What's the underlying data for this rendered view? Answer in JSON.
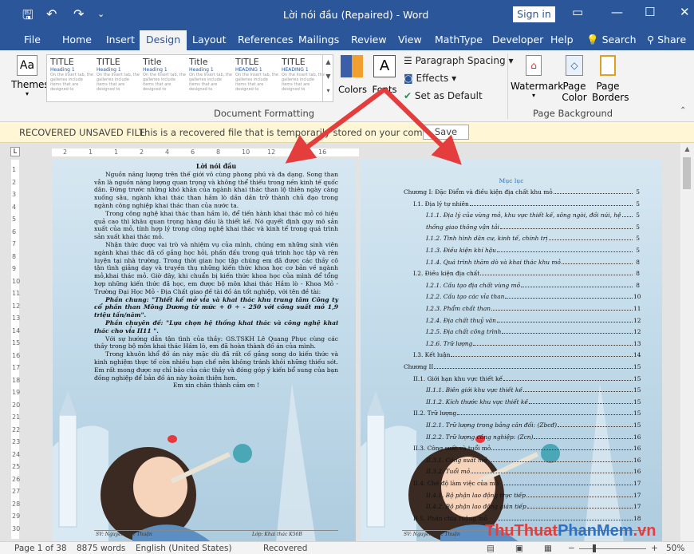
{
  "window": {
    "title": "Lời nói đầu (Repaired)  -  Word",
    "signin": "Sign in",
    "minimize": "—",
    "restore": "☐",
    "close": "✕"
  },
  "quick_access": {
    "save": "🖫",
    "undo": "↶",
    "redo": "↷",
    "more": "⌄"
  },
  "tabs": [
    "File",
    "Home",
    "Insert",
    "Design",
    "Layout",
    "References",
    "Mailings",
    "Review",
    "View",
    "MathType",
    "Developer",
    "Help"
  ],
  "active_tab": "Design",
  "tell_me": "Search",
  "share": "Share",
  "ribbon": {
    "themes_label": "Themes",
    "style_titles": [
      "TITLE",
      "TITLE",
      "Title",
      "Title",
      "TITLE",
      "TITLE"
    ],
    "style_headings": [
      "Heading 1",
      "Heading 1",
      "Heading 1",
      "Heading 1",
      "HEADING 1",
      "HEADING 1"
    ],
    "style_sample": "On the Insert tab, the galleries include items that are designed to",
    "colors_label": "Colors",
    "fonts_label": "Fonts",
    "fonts_glyph": "A",
    "paragraph_spacing": "Paragraph Spacing",
    "effects": "Effects",
    "set_default": "Set as Default",
    "group_document_formatting": "Document Formatting",
    "watermark": "Watermark",
    "page_color": "Page Color",
    "page_borders": "Page Borders",
    "group_page_background": "Page Background"
  },
  "notification": {
    "title": "RECOVERED UNSAVED FILE",
    "message": "This is a recovered file that is temporarily stored on your computer.",
    "save_button": "Save"
  },
  "page1": {
    "heading": "Lời nói đầu",
    "paragraphs": [
      "Nguồn năng lượng trên thế giới vô cùng phong phú và đa dạng. Song than vẫn là nguồn năng lượng quan trọng và không thể thiếu trong nền kinh tế quốc dân. Đứng trước những khó khăn của ngành khai thác than lộ thiên ngày càng xuống sâu, ngành khai thác than hầm lò dần dần trở thành chủ đạo trong ngành công nghiệp khai thác than của nước ta.",
      "Trong công nghệ khai thác than hầm lò, để tiến hành khai thác mỏ có hiệu quả cao thì khâu quan trọng hàng đầu là thiết kế. Nó quyết định quy mô sản xuất của mỏ, tính hợp lý trong công nghệ khai thác và kinh tế trong quá trình sản xuất khai thác mỏ.",
      "Nhận thức được vai trò và nhiệm vụ của mình, chúng em những sinh viên ngành khai thác đã cố gắng học hỏi, phấn đấu trong quá trình học tập và rèn luyện tại nhà trường. Trong thời gian học tập chúng em đã được các thầy cô tận tình giảng dạy và truyền thụ những kiến thức khoa học cơ bản về ngành mỏ,khai thác mỏ. Giờ đây, khi chuẩn bị kiến thức khoa học của mình để tổng hợp những kiến thức đã học, em được bộ môn khai thác Hầm lò - Khoa Mỏ - Trường Đại Học Mỏ - Địa Chất giao đề tài đồ án tốt nghiệp, với tên đề tài:",
      "Phần chung: \"Thiết kế mở vỉa và khai thác khu trung tâm Công ty cổ phần than Mông Dương từ mức + 0 ÷ - 250 với công suất mỏ 1,9 triệu tấn/năm\".",
      "Phần chuyên đề: \"Lựa chọn hệ thống khai thác và công nghệ khai thác cho vỉa II11 \".",
      "Với sự hướng dẫn tận tình của thầy: GS.TSKH Lê Quang Phục cùng các thầy trong bộ môn khai thác Hầm lò, em đã hoàn thành đồ án của mình.",
      "Trong khuôn khổ đồ án này mặc dù đã rất cố gắng song do kiến thức và kinh nghiệm thực tế còn nhiều hạn chế nên không tránh khỏi những thiếu sót. Em rất mong được sự chỉ bảo của các thầy và đóng góp ý kiến bổ sung của bạn đồng nghiệp để bản đồ án này hoàn thiện hơn.",
      "Em xin chân thành cảm ơn !"
    ],
    "footer_left": "SV: Nguyễn Đức Thuận",
    "footer_right": "Lớp: Khai thác K56B"
  },
  "page2": {
    "toc_title": "Mục lục",
    "toc": [
      {
        "label": "Chương I: Đặc Điểm và điều kiện địa chất khu mỏ",
        "page": "5",
        "level": 0,
        "italic": false
      },
      {
        "label": "I.1. Địa lý tự  nhiên",
        "page": "5",
        "level": 1,
        "italic": false
      },
      {
        "label": "I.1.1. Địa lý của vùng mỏ, khu vực thiết kế, sông ngòi, đồi núi, hệ",
        "page": "5",
        "level": 2,
        "italic": true
      },
      {
        "label": "thống giao thông vận tải",
        "page": "5",
        "level": 2,
        "italic": true
      },
      {
        "label": "I.1.2.  Tình hình dân cư, kinh tế, chính trị",
        "page": "5",
        "level": 2,
        "italic": true
      },
      {
        "label": "I.1.3. Điều kiện khí hậu",
        "page": "5",
        "level": 2,
        "italic": true
      },
      {
        "label": "I.1.4. Quá trình thăm dò và khai thác khu mỏ",
        "page": "8",
        "level": 2,
        "italic": true
      },
      {
        "label": "I.2. Điều kiện địa chất",
        "page": "8",
        "level": 1,
        "italic": false
      },
      {
        "label": "I.2.1.  Cấu tạo địa chất vùng mỏ",
        "page": "8",
        "level": 2,
        "italic": true
      },
      {
        "label": "I.2.2. Cấu tạo các vỉa than",
        "page": "10",
        "level": 2,
        "italic": true
      },
      {
        "label": "I.2.3. Phẩm chất than",
        "page": "11",
        "level": 2,
        "italic": true
      },
      {
        "label": "I.2.4. Địa chất thuỷ văn",
        "page": "12",
        "level": 2,
        "italic": true
      },
      {
        "label": "I.2.5. Địa chất công trình",
        "page": "12",
        "level": 2,
        "italic": true
      },
      {
        "label": "I.2.6. Trữ lượng",
        "page": "13",
        "level": 2,
        "italic": true
      },
      {
        "label": "I.3. Kết luận",
        "page": "14",
        "level": 1,
        "italic": false
      },
      {
        "label": "Chương II",
        "page": "15",
        "level": 0,
        "italic": false
      },
      {
        "label": "II.1. Giới hạn khu vực thiết kế",
        "page": "15",
        "level": 1,
        "italic": false
      },
      {
        "label": "II.1.1. Biên giới khu vực thiết kế",
        "page": "15",
        "level": 2,
        "italic": true
      },
      {
        "label": "II.1.2. Kích thước khu vực thiết kế",
        "page": "15",
        "level": 2,
        "italic": true
      },
      {
        "label": "II.2. Trữ lượng",
        "page": "15",
        "level": 1,
        "italic": false
      },
      {
        "label": "II.2.1. Trữ lượng trong bảng cân đối: (Zbcđ)",
        "page": "15",
        "level": 2,
        "italic": true
      },
      {
        "label": "II.2.2. Trữ lượng công nghiệp: (Zcn)",
        "page": "16",
        "level": 2,
        "italic": true
      },
      {
        "label": "II.3. Công suất và tuổi mỏ",
        "page": "16",
        "level": 1,
        "italic": false
      },
      {
        "label": "II.3.1. Công suất mỏ",
        "page": "16",
        "level": 2,
        "italic": true
      },
      {
        "label": "II.3.2. Tuổi mỏ",
        "page": "16",
        "level": 2,
        "italic": true
      },
      {
        "label": "II.4. Chế độ làm việc của mỏ",
        "page": "17",
        "level": 1,
        "italic": false
      },
      {
        "label": "II.4.1. Bộ phận lao động trực tiếp",
        "page": "17",
        "level": 2,
        "italic": true
      },
      {
        "label": "II.4.2. Bộ phận lao động gián tiếp",
        "page": "17",
        "level": 2,
        "italic": true
      },
      {
        "label": "II.5. Phân chia ruộng mỏ",
        "page": "18",
        "level": 1,
        "italic": false
      }
    ],
    "footer_left": "SV: Nguyễn Đức Thuận"
  },
  "ruler_numbers": [
    "2",
    "1",
    "1",
    "2",
    "4",
    "6",
    "8",
    "10",
    "12",
    "14",
    "16"
  ],
  "vruler_numbers": [
    "1",
    "2",
    "3",
    "4",
    "5",
    "6",
    "7",
    "8",
    "9",
    "10",
    "11",
    "12",
    "13",
    "14",
    "15",
    "16",
    "17",
    "18",
    "19",
    "20",
    "21",
    "22",
    "23",
    "24",
    "25",
    "26",
    "27",
    "28",
    "29",
    "30"
  ],
  "status": {
    "page": "Page 1 of 38",
    "words": "8875 words",
    "language": "English (United States)",
    "recovered": "Recovered",
    "zoom_minus": "−",
    "zoom_plus": "+",
    "zoom": "50%"
  },
  "watermark": {
    "part1": "ThuThuat",
    "part2": "PhanMem",
    "part3": ".vn"
  },
  "colors": {
    "word_blue": "#2b579a",
    "arrow_red": "#e43d3d",
    "toc_blue": "#2e74b5"
  }
}
